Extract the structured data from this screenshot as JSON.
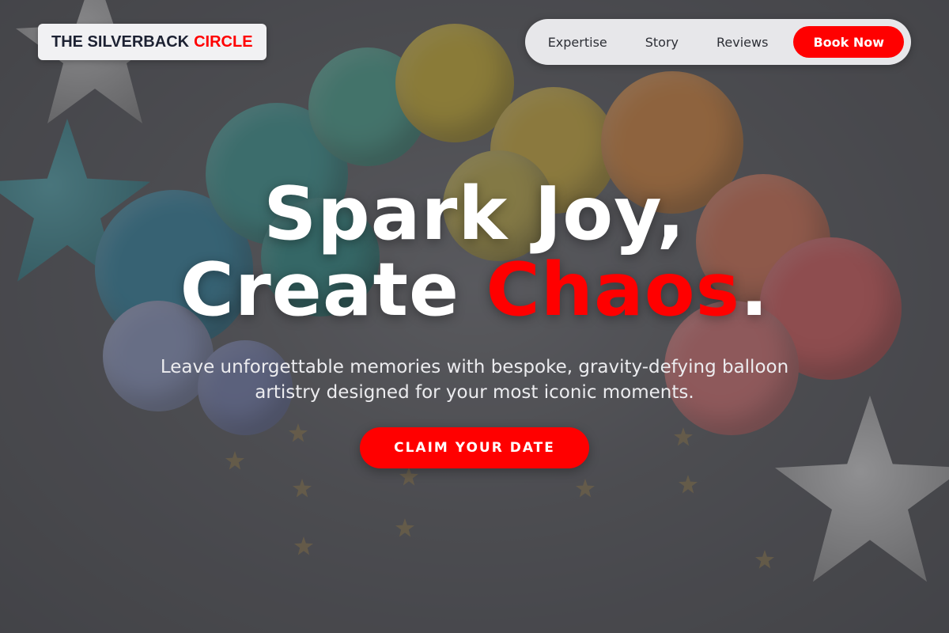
{
  "brand": {
    "name_dark": "THE SILVERBACK",
    "name_accent": "CIRCLE",
    "accent_color": "#ff0000",
    "dark_color": "#1d2233"
  },
  "nav": {
    "links": [
      "Expertise",
      "Story",
      "Reviews"
    ],
    "cta_label": "Book Now"
  },
  "hero": {
    "line1": "Spark Joy,",
    "line2_prefix": "Create",
    "line2_accent": "Chaos",
    "line2_suffix": ".",
    "subtitle": "Leave unforgettable memories with bespoke, gravity-defying balloon artistry designed for your most iconic moments.",
    "cta_label": "CLAIM YOUR DATE"
  },
  "background": {
    "image": "balloon-garland-photo",
    "balloon_colors": [
      "#3aa6a0",
      "#e6c52e",
      "#f0913a",
      "#ef5f5f",
      "#9aa8d8",
      "#2f8fb0"
    ]
  }
}
